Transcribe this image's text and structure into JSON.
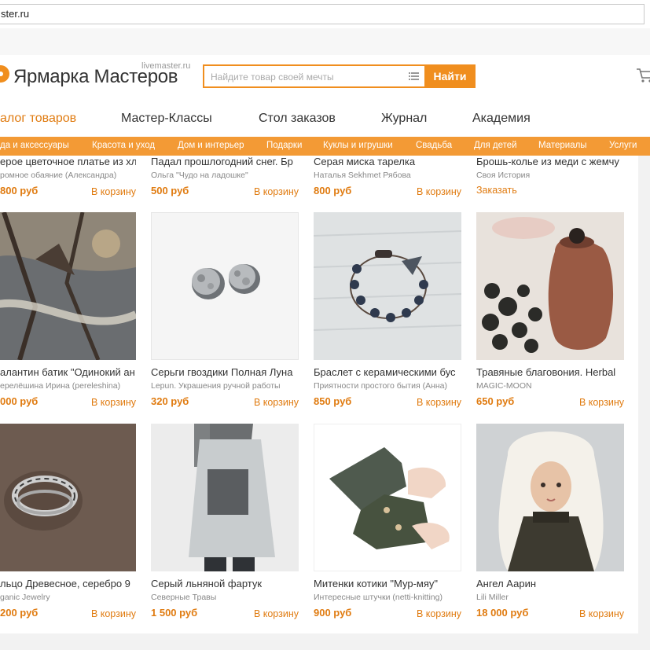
{
  "browser": {
    "url": "ster.ru"
  },
  "header": {
    "logo_text": "Ярмарка Мастеров",
    "logo_sub": "livemaster.ru",
    "search_placeholder": "Найдите товар своей мечты",
    "search_button": "Найти"
  },
  "main_nav": [
    "алог товаров",
    "Мастер-Классы",
    "Стол заказов",
    "Журнал",
    "Академия"
  ],
  "categories": [
    "да и аксессуары",
    "Красота и уход",
    "Дом и интерьер",
    "Подарки",
    "Куклы и игрушки",
    "Свадьба",
    "Для детей",
    "Материалы",
    "Услуги"
  ],
  "products": [
    {
      "title": "ерое цветочное платье из хл",
      "shop": "ромное обаяние (Александра)",
      "price": "800 руб",
      "action": "В корзину",
      "icon": "top-cropped"
    },
    {
      "title": "Падал прошлогодний снег. Бр",
      "shop": "Ольга \"Чудо на ладошке\"",
      "price": "500 руб",
      "action": "В корзину",
      "icon": "top-cropped"
    },
    {
      "title": "Серая миска тарелка",
      "shop": "Наталья Sekhmet Рябова",
      "price": "800 руб",
      "action": "В корзину",
      "icon": "top-cropped"
    },
    {
      "title": "Брошь-колье из меди с жемчу",
      "shop": "Своя История",
      "price": "",
      "action": "Заказать",
      "icon": "top-cropped"
    },
    {
      "title": "алантин батик \"Одинокий ан",
      "shop": "ерелёшина Ирина (pereleshina)",
      "price": "000 руб",
      "action": "В корзину",
      "icon": "batik-scarf-image"
    },
    {
      "title": "Серьги гвоздики Полная Луна",
      "shop": "Lepun. Украшения ручной работы",
      "price": "320 руб",
      "action": "В корзину",
      "icon": "moon-earrings-image"
    },
    {
      "title": "Браслет с керамическими бус",
      "shop": "Приятности простого бытия (Анна)",
      "price": "850 руб",
      "action": "В корзину",
      "icon": "bracelet-image"
    },
    {
      "title": "Травяные благовония. Herbal",
      "shop": "MAGIC-MOON",
      "price": "650 руб",
      "action": "В корзину",
      "icon": "incense-image"
    },
    {
      "title": "льцо Древесное, серебро 9",
      "shop": "ganic Jewelry",
      "price": "200 руб",
      "action": "В корзину",
      "icon": "ring-image"
    },
    {
      "title": "Серый льняной фартук",
      "shop": "Северные Травы",
      "price": "1 500 руб",
      "action": "В корзину",
      "icon": "apron-image"
    },
    {
      "title": "Митенки котики \"Мур-мяу\"",
      "shop": "Интересные штучки (netti-knitting)",
      "price": "900 руб",
      "action": "В корзину",
      "icon": "mittens-image"
    },
    {
      "title": "Ангел Аарин",
      "shop": "Lili Miller",
      "price": "18 000 руб",
      "action": "В корзину",
      "icon": "doll-image"
    }
  ]
}
